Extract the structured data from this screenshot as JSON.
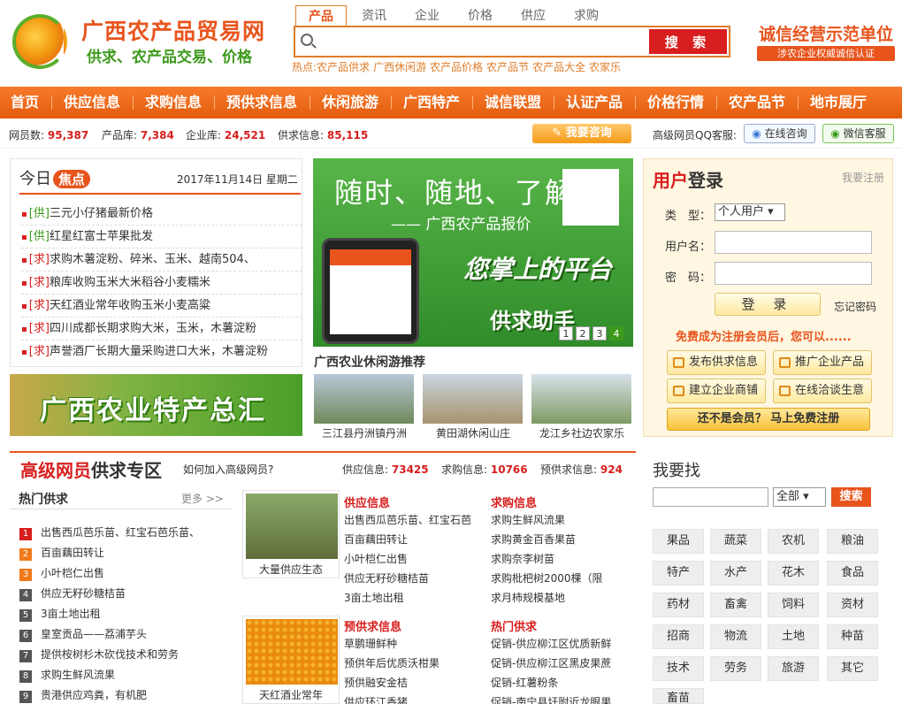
{
  "header": {
    "site_title": "广西农产品贸易网",
    "site_subtitle": "供求、农产品交易、价格",
    "search_tabs": [
      "产品",
      "资讯",
      "企业",
      "价格",
      "供应",
      "求购"
    ],
    "search_placeholder": "",
    "search_button": "搜 索",
    "hot_label": "热点:",
    "hot_words": [
      "农产品供求",
      "广西休闲游",
      "农产品价格",
      "农产品节",
      "农产品大全",
      "农家乐"
    ],
    "credit_title": "诚信经营示范单位",
    "credit_sub": "涉农企业权威诚信认证"
  },
  "nav": [
    "首页",
    "供应信息",
    "求购信息",
    "预供求信息",
    "休闲旅游",
    "广西特产",
    "诚信联盟",
    "认证产品",
    "价格行情",
    "农产品节",
    "地市展厅"
  ],
  "stats": [
    {
      "label": "网员数:",
      "value": "95,387"
    },
    {
      "label": "产品库:",
      "value": "7,384"
    },
    {
      "label": "企业库:",
      "value": "24,521"
    },
    {
      "label": "供求信息:",
      "value": "85,115"
    }
  ],
  "consult_label": "我要咨询",
  "qq_label": "高级网员QQ客服:",
  "qq_online": "在线咨询",
  "wechat_service": "微信客服",
  "today": {
    "title_a": "今日",
    "title_b": "焦点",
    "date": "2017年11月14日 星期二",
    "news": [
      {
        "tag": "[供]",
        "text": "三元小仔猪最新价格"
      },
      {
        "tag": "[供]",
        "text": "红星红富士苹果批发"
      },
      {
        "tag": "[求]",
        "text": "求购木薯淀粉、碎米、玉米、越南504、"
      },
      {
        "tag": "[求]",
        "text": "粮库收购玉米大米稻谷小麦糯米"
      },
      {
        "tag": "[求]",
        "text": "天红酒业常年收购玉米小麦高粱"
      },
      {
        "tag": "[求]",
        "text": "四川成都长期求购大米，玉米，木薯淀粉"
      },
      {
        "tag": "[求]",
        "text": "声誉酒厂长期大量采购进口大米，木薯淀粉"
      }
    ]
  },
  "special_banner": "广西农业特产总汇",
  "app_banner": {
    "title": "随时、随地、了解",
    "subtitle": "—— 广西农产品报价",
    "slogan": "您掌上的平台",
    "helper": "供求助手",
    "pages": [
      "1",
      "2",
      "3",
      "4"
    ]
  },
  "tour": {
    "title": "广西农业休闲游推荐",
    "items": [
      "三江县丹洲镇丹洲",
      "黄田湖休闲山庄",
      "龙江乡社边农家乐"
    ]
  },
  "login": {
    "title_a": "用户",
    "title_b": "登录",
    "register": "我要注册",
    "type_label": "类　型：",
    "type_value": "个人用户 ▾",
    "user_label": "用户名：",
    "pass_label": "密　码：",
    "login_button": "登 录",
    "forgot": "忘记密码",
    "hint": "免费成为注册会员后，您可以......",
    "actions": [
      "发布供求信息",
      "推广企业产品",
      "建立企业商铺",
      "在线洽谈生意"
    ],
    "free_register": "还不是会员？ 马上免费注册"
  },
  "premium": {
    "title_a": "高级网员",
    "title_b": "供求专区",
    "join": "如何加入高级网员?",
    "stats": [
      {
        "label": "供应信息:",
        "value": "73425"
      },
      {
        "label": "求购信息:",
        "value": "10766"
      },
      {
        "label": "预供求信息:",
        "value": "924"
      }
    ],
    "hot_title": "热门供求",
    "more": "更多 >>",
    "hot_items": [
      "出售西瓜芭乐苗、红宝石芭乐苗、",
      "百亩藕田转让",
      "小叶桤仁出售",
      "供应无籽砂糖桔苗",
      "3亩土地出租",
      "皇室贡品——荔浦芋头",
      "提供桉树杉木砍伐技术和劳务",
      "求购生鲜风流果",
      "贵港供应鸡粪，有机肥"
    ],
    "photos": [
      "大量供应生态",
      "天红酒业常年"
    ],
    "supply_title": "供应信息",
    "supply_items": [
      "出售西瓜芭乐苗、红宝石芭",
      "百亩藕田转让",
      "小叶桤仁出售",
      "供应无籽砂糖桔苗",
      "3亩土地出租"
    ],
    "demand_title": "求购信息",
    "demand_items": [
      "求购生鲜风流果",
      "求购黄金百香果苗",
      "求购奈李树苗",
      "求购枇杷树2000棵（限",
      "求月柿规模基地"
    ],
    "pre_title": "预供求信息",
    "pre_items": [
      "草鹏珊鲜种",
      "预供年后优质沃柑果",
      "预供融安金桔",
      "供应环江香猪"
    ],
    "hot2_title": "热门供求",
    "hot2_items": [
      "促销-供应柳江区优质新鲜",
      "促销-供应柳江区黑皮果蔗",
      "促销-红薯粉条",
      "促销-南宁县圩附近龙眼果"
    ]
  },
  "find": {
    "title": "我要找",
    "select": "全部 ▾",
    "button": "搜索",
    "categories": [
      "果品",
      "蔬菜",
      "农机",
      "粮油",
      "特产",
      "水产",
      "花木",
      "食品",
      "药材",
      "畜禽",
      "饲料",
      "资材",
      "招商",
      "物流",
      "土地",
      "种苗",
      "技术",
      "劳务",
      "旅游",
      "其它",
      "畜苗"
    ]
  }
}
